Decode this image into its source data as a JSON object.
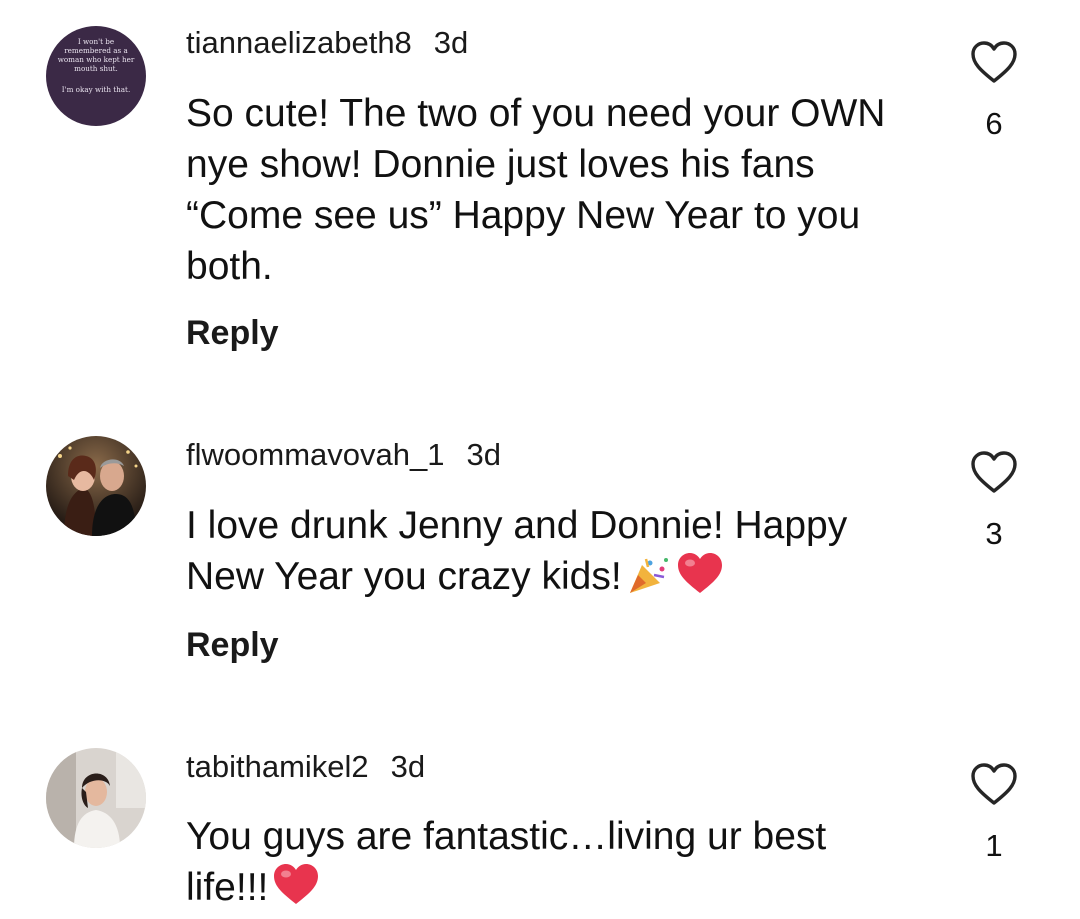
{
  "comments": [
    {
      "username": "tiannaelizabeth8",
      "time": "3d",
      "text": "So cute! The two of you need your OWN nye show! Donnie just loves his fans “Come see us” Happy New Year to you both.",
      "likes": "6",
      "reply_label": "Reply",
      "avatar_text": [
        "I won't be",
        "remembered as a",
        "woman who kept her",
        "mouth shut.",
        "I'm okay with that."
      ]
    },
    {
      "username": "flwoommavovah_1",
      "time": "3d",
      "text": "I love drunk Jenny and Donnie! Happy New Year you crazy kids!",
      "emojis": [
        "party-popper",
        "red-heart"
      ],
      "likes": "3",
      "reply_label": "Reply"
    },
    {
      "username": "tabithamikel2",
      "time": "3d",
      "text": "You guys are fantastic…living ur best life!!!",
      "emojis": [
        "red-heart"
      ],
      "likes": "1"
    }
  ],
  "colors": {
    "text": "#111111",
    "heart_outline": "#262626",
    "heart_emoji": "#e8344e",
    "avatar1_bg": "#3a2a45"
  }
}
